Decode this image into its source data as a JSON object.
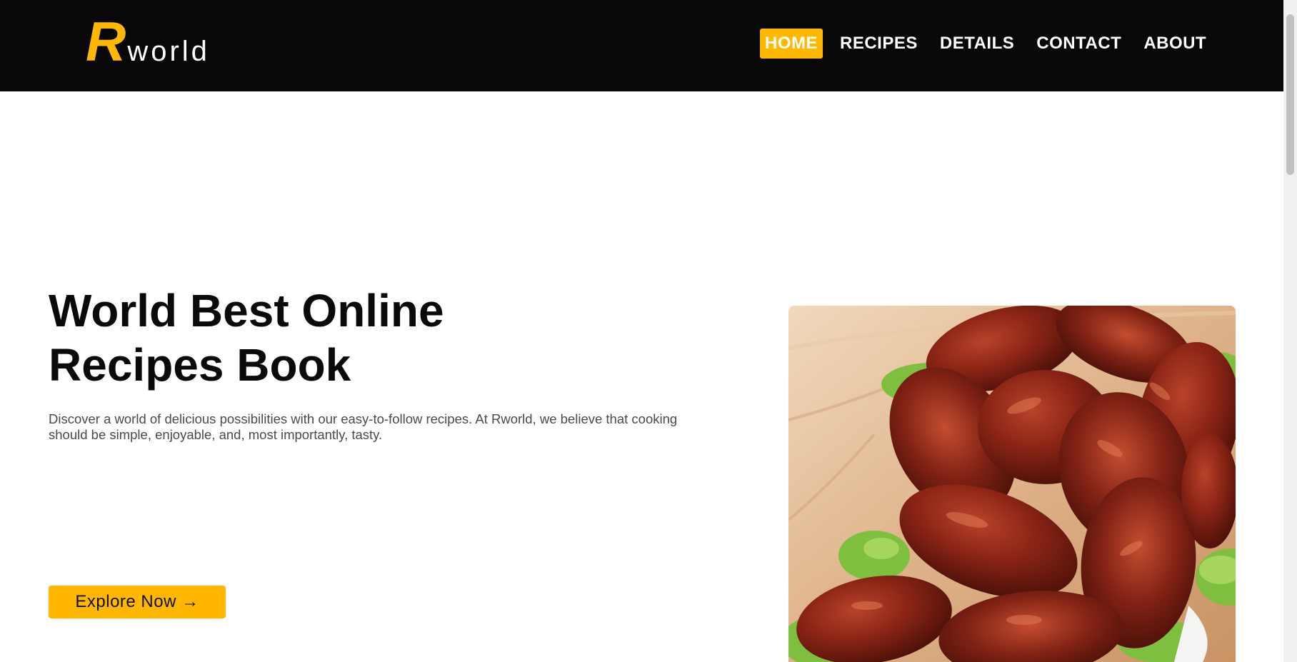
{
  "logo": {
    "initial": "R",
    "rest": "world"
  },
  "nav": {
    "items": [
      {
        "label": "HOME",
        "active": true
      },
      {
        "label": "RECIPES",
        "active": false
      },
      {
        "label": "DETAILS",
        "active": false
      },
      {
        "label": "CONTACT",
        "active": false
      },
      {
        "label": "ABOUT",
        "active": false
      }
    ]
  },
  "hero": {
    "title_line1": "World Best Online",
    "title_line2": "Recipes Book",
    "description": "Discover a world of delicious possibilities with our easy-to-follow recipes. At Rworld, we believe that cooking should be simple, enjoyable, and, most importantly, tasty.",
    "button_label": "Explore Now →"
  },
  "colors": {
    "header_bg": "#080808",
    "accent": "#ffb700",
    "text_dark": "#0a0a0a",
    "text_muted": "#4a4a4a"
  }
}
